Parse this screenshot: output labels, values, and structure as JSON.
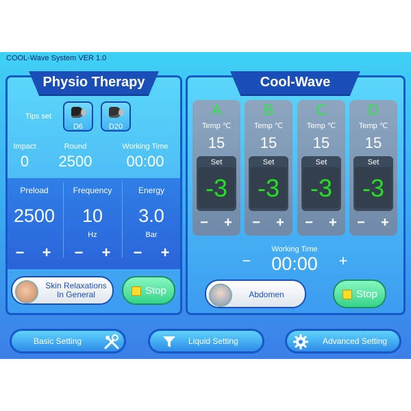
{
  "system": {
    "title": "COOL-Wave System VER 1.0"
  },
  "physio": {
    "title": "Physio Therapy",
    "tips_label": "Tips set",
    "tips": [
      {
        "label": "D6"
      },
      {
        "label": "D20"
      }
    ],
    "stats": [
      {
        "label": "Impact",
        "value": "0"
      },
      {
        "label": "Round",
        "value": "2500"
      },
      {
        "label": "Working Time",
        "value": "00:00"
      }
    ],
    "params": [
      {
        "label": "Preload",
        "value": "2500",
        "unit": ""
      },
      {
        "label": "Frequency",
        "value": "10",
        "unit": "Hz"
      },
      {
        "label": "Energy",
        "value": "3.0",
        "unit": "Bar"
      }
    ],
    "minus": "−",
    "plus": "+",
    "mode_label": "Skin Relaxations\nIn General",
    "stop_label": "Stop"
  },
  "coolwave": {
    "title": "Cool-Wave",
    "channels": [
      {
        "letter": "A",
        "temp_label": "Temp ℃",
        "temp": "15",
        "set_label": "Set",
        "set_value": "-3"
      },
      {
        "letter": "B",
        "temp_label": "Temp ℃",
        "temp": "15",
        "set_label": "Set",
        "set_value": "-3"
      },
      {
        "letter": "C",
        "temp_label": "Temp ℃",
        "temp": "15",
        "set_label": "Set",
        "set_value": "-3"
      },
      {
        "letter": "D",
        "temp_label": "Temp ℃",
        "temp": "15",
        "set_label": "Set",
        "set_value": "-3"
      }
    ],
    "working_time_label": "Working Time",
    "working_time": "00:00",
    "minus": "−",
    "plus": "+",
    "mode_label": "Abdomen",
    "stop_label": "Stop"
  },
  "bottom": {
    "basic": "Basic Setting",
    "liquid": "Liquid Setting",
    "advanced": "Advanced Setting"
  },
  "colors": {
    "accent": "#1758c8",
    "set_value": "#22e020",
    "letter": "#32e24a"
  }
}
